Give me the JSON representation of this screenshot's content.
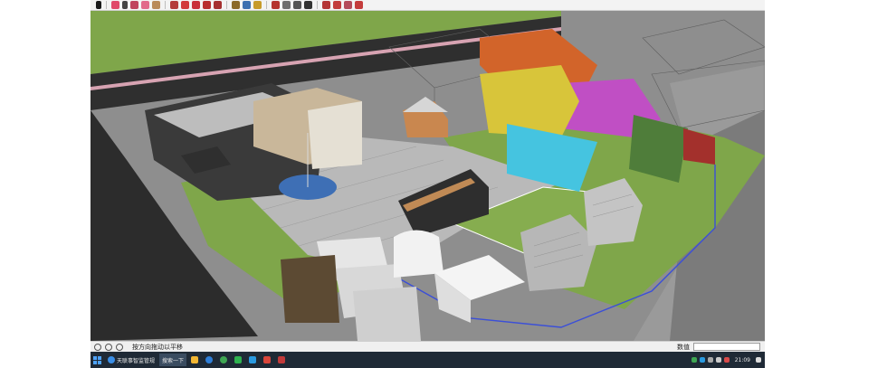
{
  "toolbar": {
    "buttons": [
      "select-tool-icon",
      "eraser-icon",
      "pencil-icon",
      "line-icon",
      "arc-icon",
      "shape-icon",
      "rectangle-icon",
      "push-pull-icon",
      "move-icon",
      "rotate-icon",
      "offset-icon",
      "scale-icon",
      "tape-measure-icon",
      "text-icon",
      "paint-icon",
      "orbit-icon",
      "pan-icon",
      "zoom-icon",
      "zoom-extents-icon",
      "section-icon",
      "component-icon",
      "warehouse-icon",
      "extension-icon",
      "ruby-icon"
    ]
  },
  "statusbar": {
    "hint": "按方向拖动以平移",
    "vcb_label": "数值"
  },
  "taskbar": {
    "search_label": "天联事智监管规",
    "app_label": "搜索一下",
    "clock": "21:09"
  },
  "colors": {
    "ground_green": "#7fa64a",
    "asphalt": "#2f2f2f",
    "pink_strip": "#d7a3b2",
    "paving": "#b9b9b9",
    "orange_container": "#d2642a",
    "magenta_container": "#c04fc4",
    "yellow_frame": "#d8c53a",
    "cyan_pool": "#45c4e0",
    "green_container": "#4f7d3a",
    "red_container": "#a3302c"
  }
}
